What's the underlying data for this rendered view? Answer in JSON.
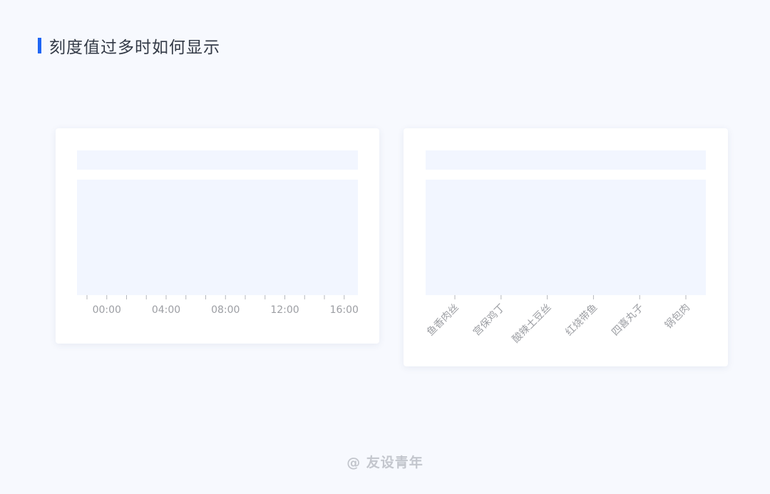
{
  "page": {
    "title": "刻度值过多时如何显示",
    "footer": "@ 友设青年",
    "accent_color": "#1f66f5"
  },
  "chart_data": [
    {
      "type": "bar",
      "x_axis": {
        "tick_count": 14,
        "labels": [
          "00:00",
          "04:00",
          "08:00",
          "12:00",
          "16:00"
        ],
        "label_every": 3,
        "label_rotation": 0
      },
      "values": []
    },
    {
      "type": "bar",
      "x_axis": {
        "tick_count": 6,
        "labels": [
          "鱼香肉丝",
          "宫保鸡丁",
          "酸辣土豆丝",
          "红烧带鱼",
          "四喜丸子",
          "锅包肉"
        ],
        "label_every": 1,
        "label_rotation": -45
      },
      "values": []
    }
  ]
}
